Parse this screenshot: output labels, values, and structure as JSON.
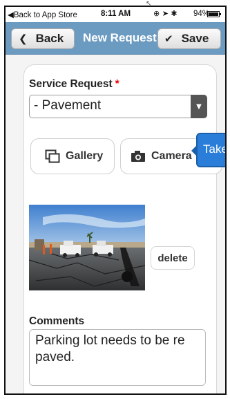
{
  "status_bar": {
    "back_to_app": "◀Back to App Store",
    "time": "8:11 AM",
    "icons": "⊕ ➤ ✱",
    "battery_percent": "94%"
  },
  "nav": {
    "back_label": "Back",
    "title": "New Request",
    "save_label": "Save"
  },
  "form": {
    "service_request_label": "Service Request",
    "required_mark": "*",
    "service_request_value": "- Pavement",
    "gallery_label": "Gallery",
    "camera_label": "Camera",
    "tooltip_text": "Take",
    "delete_label": "delete",
    "comments_label": "Comments",
    "comments_value": "Parking lot needs to be re paved."
  },
  "colors": {
    "navbar": "#6c9bc2",
    "tooltip": "#2a7ed9",
    "required": "#ee0000"
  },
  "icons": {
    "back": "chevron-left-icon",
    "save": "checkmark-icon",
    "gallery": "gallery-icon",
    "camera": "camera-icon",
    "select_arrow": "dropdown-arrow-icon"
  }
}
